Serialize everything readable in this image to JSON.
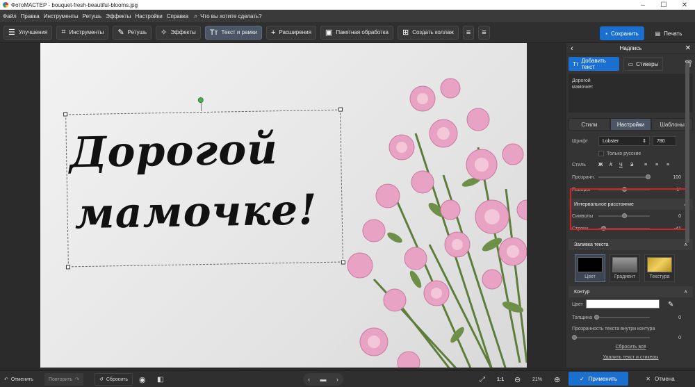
{
  "window": {
    "title": "ФотоМАСТЕР - bouquet-fresh-beautiful-blooms.jpg"
  },
  "menu": {
    "items": [
      "Файл",
      "Правка",
      "Инструменты",
      "Ретушь",
      "Эффекты",
      "Настройки",
      "Справка"
    ],
    "search_placeholder": "Что вы хотите сделать?"
  },
  "toolbar": {
    "improve": "Улучшения",
    "tools": "Инструменты",
    "retouch": "Ретушь",
    "effects": "Эффекты",
    "text": "Текст и рамки",
    "extensions": "Расширения",
    "batch": "Пакетная обработка",
    "collage": "Создать коллаж",
    "save": "Сохранить",
    "print": "Печать"
  },
  "canvas": {
    "line1": "Дорогой",
    "line2": "мамочке!"
  },
  "panel": {
    "title": "Надпись",
    "add_text": "Добавить текст",
    "stickers": "Стикеры",
    "preview_text": [
      "Дорогой",
      "мамочке!"
    ],
    "tabs": [
      "Стили",
      "Настройки",
      "Шаблоны"
    ],
    "font_label": "Шрифт",
    "font_value": "Lobster",
    "font_size": "780",
    "russian_only": "Только русские",
    "style_label": "Стиль",
    "opacity_label": "Прозрачн.",
    "opacity_value": "100",
    "rotate_label": "Поворот",
    "rotate_value": "-1°",
    "spacing_header": "Интервальное расстояние",
    "chars_label": "Символы",
    "chars_value": "0",
    "lines_label": "Строки",
    "lines_value": "-41",
    "fill_header": "Заливка текста",
    "fill_color": "Цвет",
    "fill_gradient": "Градиент",
    "fill_texture": "Текстура",
    "outline_header": "Контур",
    "outline_color_label": "Цвет",
    "thickness_label": "Толщина",
    "thickness_value": "0",
    "inner_opacity_label": "Прозрачность текста внутри контура",
    "inner_opacity_value": "0",
    "reset_all": "Сбросить всё",
    "delete_all": "Удалить текст и стикеры"
  },
  "bottom": {
    "undo": "Отменить",
    "redo": "Повторить",
    "reset": "Сбросить",
    "ratio": "1:1",
    "zoom": "21%",
    "apply": "Применить",
    "cancel": "Отмена"
  },
  "colors": {
    "accent": "#1b6fcf",
    "highlight": "#d42121",
    "rotate_handle": "#4caf50"
  }
}
